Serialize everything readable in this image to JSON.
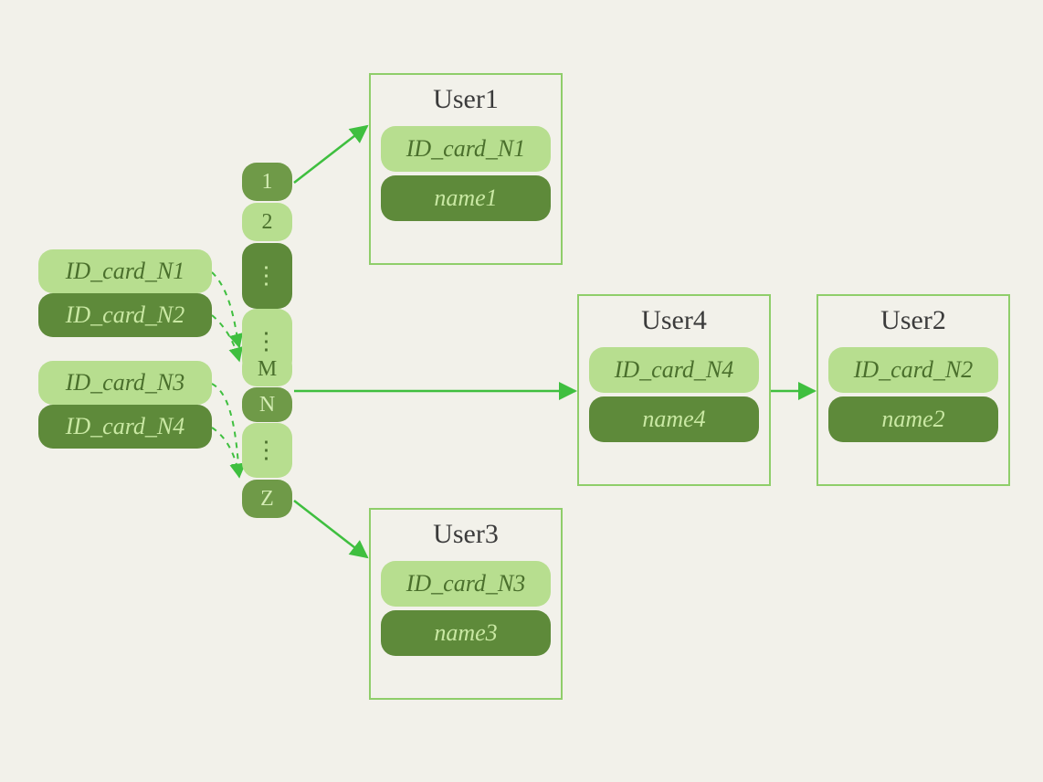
{
  "id_cards": {
    "n1": "ID_card_N1",
    "n2": "ID_card_N2",
    "n3": "ID_card_N3",
    "n4": "ID_card_N4"
  },
  "hash_slots": {
    "s1": "1",
    "s2": "2",
    "dots1": "⋮",
    "sm": "M",
    "sn": "N",
    "dots2": "⋮",
    "sz": "Z"
  },
  "users": {
    "u1": {
      "title": "User1",
      "id": "ID_card_N1",
      "name": "name1"
    },
    "u4": {
      "title": "User4",
      "id": "ID_card_N4",
      "name": "name4"
    },
    "u2": {
      "title": "User2",
      "id": "ID_card_N2",
      "name": "name2"
    },
    "u3": {
      "title": "User3",
      "id": "ID_card_N3",
      "name": "name3"
    }
  }
}
